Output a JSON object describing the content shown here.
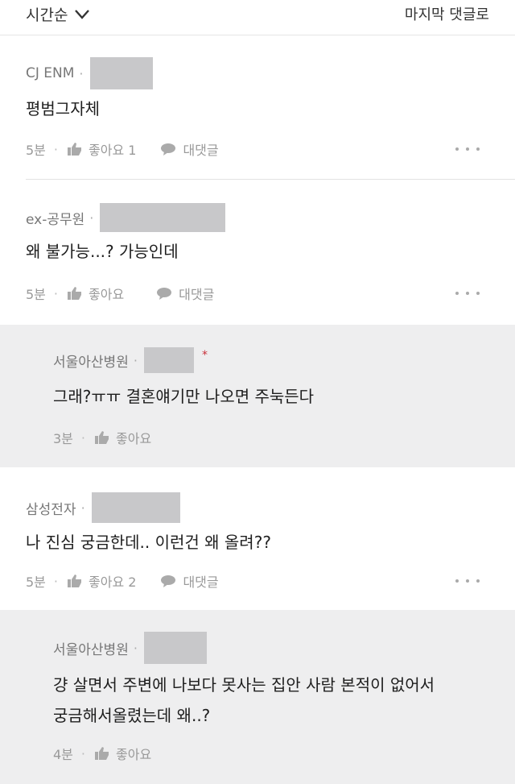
{
  "header": {
    "sort_label": "시간순",
    "last_reply_label": "마지막 댓글로"
  },
  "comments": [
    {
      "author": "CJ ENM",
      "text": "평범그자체",
      "time": "5분",
      "like_label": "좋아요 1",
      "reply_label": "대댓글"
    },
    {
      "author": "ex-공무원",
      "text": "왜 불가능...? 가능인데",
      "time": "5분",
      "like_label": "좋아요",
      "reply_label": "대댓글"
    },
    {
      "author": "서울아산병원",
      "text": "그래?ㅠㅠ 결혼얘기만 나오면 주눅든다",
      "time": "3분",
      "like_label": "좋아요",
      "is_reply": true,
      "author_mark": "*"
    },
    {
      "author": "삼성전자",
      "text": "나 진심 궁금한데.. 이런건 왜 올려??",
      "time": "5분",
      "like_label": "좋아요 2",
      "reply_label": "대댓글"
    },
    {
      "author": "서울아산병원",
      "text_lines": [
        "걍 살면서 주변에 나보다 못사는 집안 사람 본적이 없어서",
        "궁금해서올렸는데 왜..?"
      ],
      "time": "4분",
      "like_label": "좋아요",
      "is_reply": true
    }
  ],
  "colors": {
    "reply_background": "#eeeeef",
    "redaction": "#c8c8ca",
    "mark": "#c8303a"
  },
  "icons": [
    "chevron-down-icon",
    "thumbs-up-icon",
    "speech-bubble-icon",
    "more-dots-icon"
  ]
}
